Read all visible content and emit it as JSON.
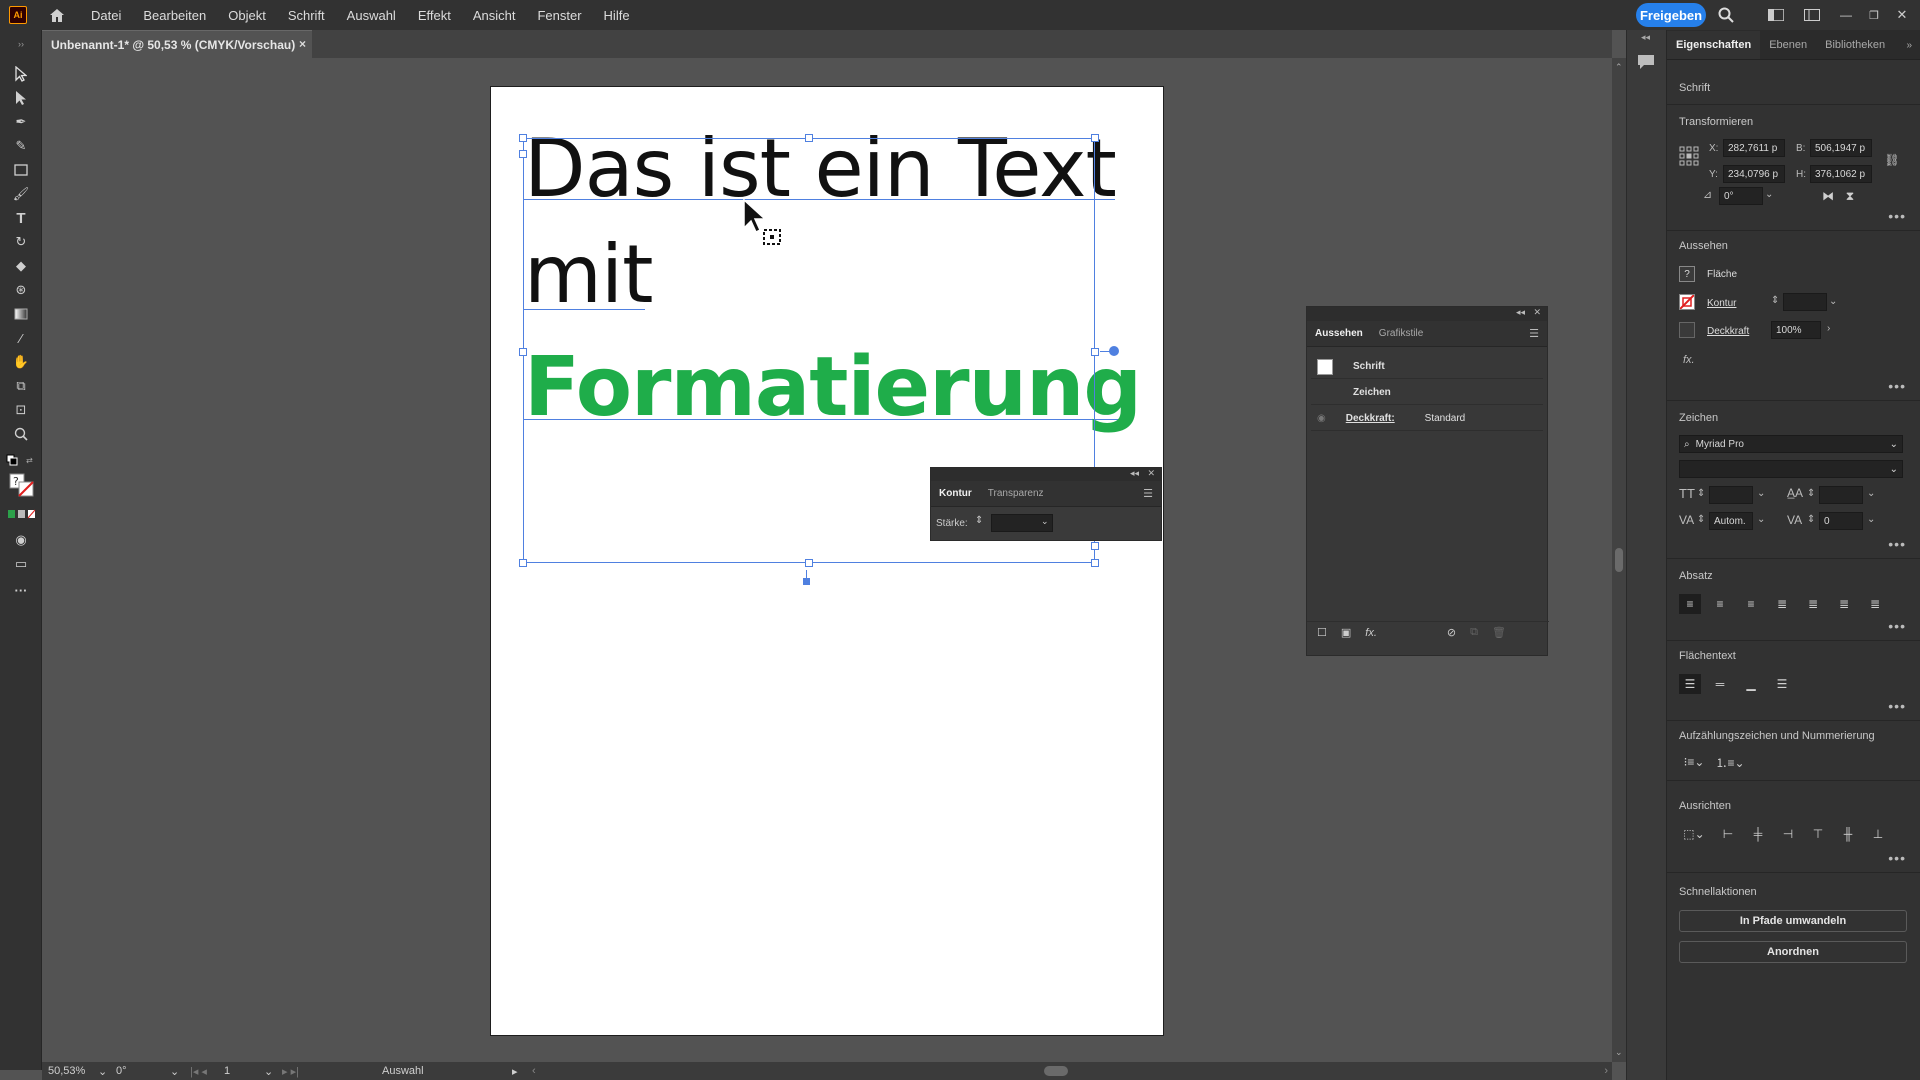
{
  "app": {
    "logo": "Ai",
    "share_label": "Freigeben"
  },
  "menu": [
    "Datei",
    "Bearbeiten",
    "Objekt",
    "Schrift",
    "Auswahl",
    "Effekt",
    "Ansicht",
    "Fenster",
    "Hilfe"
  ],
  "document": {
    "tab_title": "Unbenannt-1* @ 50,53 % (CMYK/Vorschau)",
    "close": "×"
  },
  "canvas": {
    "line1": "Das ist ein Text",
    "line2": "mit",
    "line3": "Formatierung",
    "highlight_color": "#1fad4a"
  },
  "status": {
    "zoom": "50,53%",
    "rotation": "0°",
    "artboard": "1",
    "tool": "Auswahl"
  },
  "props": {
    "tabs": [
      "Eigenschaften",
      "Ebenen",
      "Bibliotheken"
    ],
    "object_type": "Schrift",
    "transform": {
      "title": "Transformieren",
      "x_label": "X:",
      "x": "282,7611 p",
      "y_label": "Y:",
      "y": "234,0796 p",
      "w_label": "B:",
      "w": "506,1947 p",
      "h_label": "H:",
      "h": "376,1062 p",
      "angle": "0°"
    },
    "appearance": {
      "title": "Aussehen",
      "fill_label": "Fläche",
      "stroke_label": "Kontur",
      "opacity_label": "Deckkraft",
      "opacity": "100%",
      "fx": "fx."
    },
    "character": {
      "title": "Zeichen",
      "font": "Myriad Pro",
      "tracking_auto": "Autom.",
      "kerning": "0"
    },
    "paragraph": {
      "title": "Absatz"
    },
    "area_text": {
      "title": "Flächentext"
    },
    "bullets": {
      "title": "Aufzählungszeichen und Nummerierung"
    },
    "align": {
      "title": "Ausrichten"
    },
    "quick": {
      "title": "Schnellaktionen",
      "btn1": "In Pfade umwandeln",
      "btn2": "Anordnen"
    }
  },
  "aussehen_panel": {
    "tabs": [
      "Aussehen",
      "Grafikstile"
    ],
    "row1": "Schrift",
    "row2": "Zeichen",
    "row3_label": "Deckkraft:",
    "row3_value": "Standard",
    "fx": "fx."
  },
  "kontur_panel": {
    "tabs": [
      "Kontur",
      "Transparenz"
    ],
    "strength_label": "Stärke:"
  }
}
